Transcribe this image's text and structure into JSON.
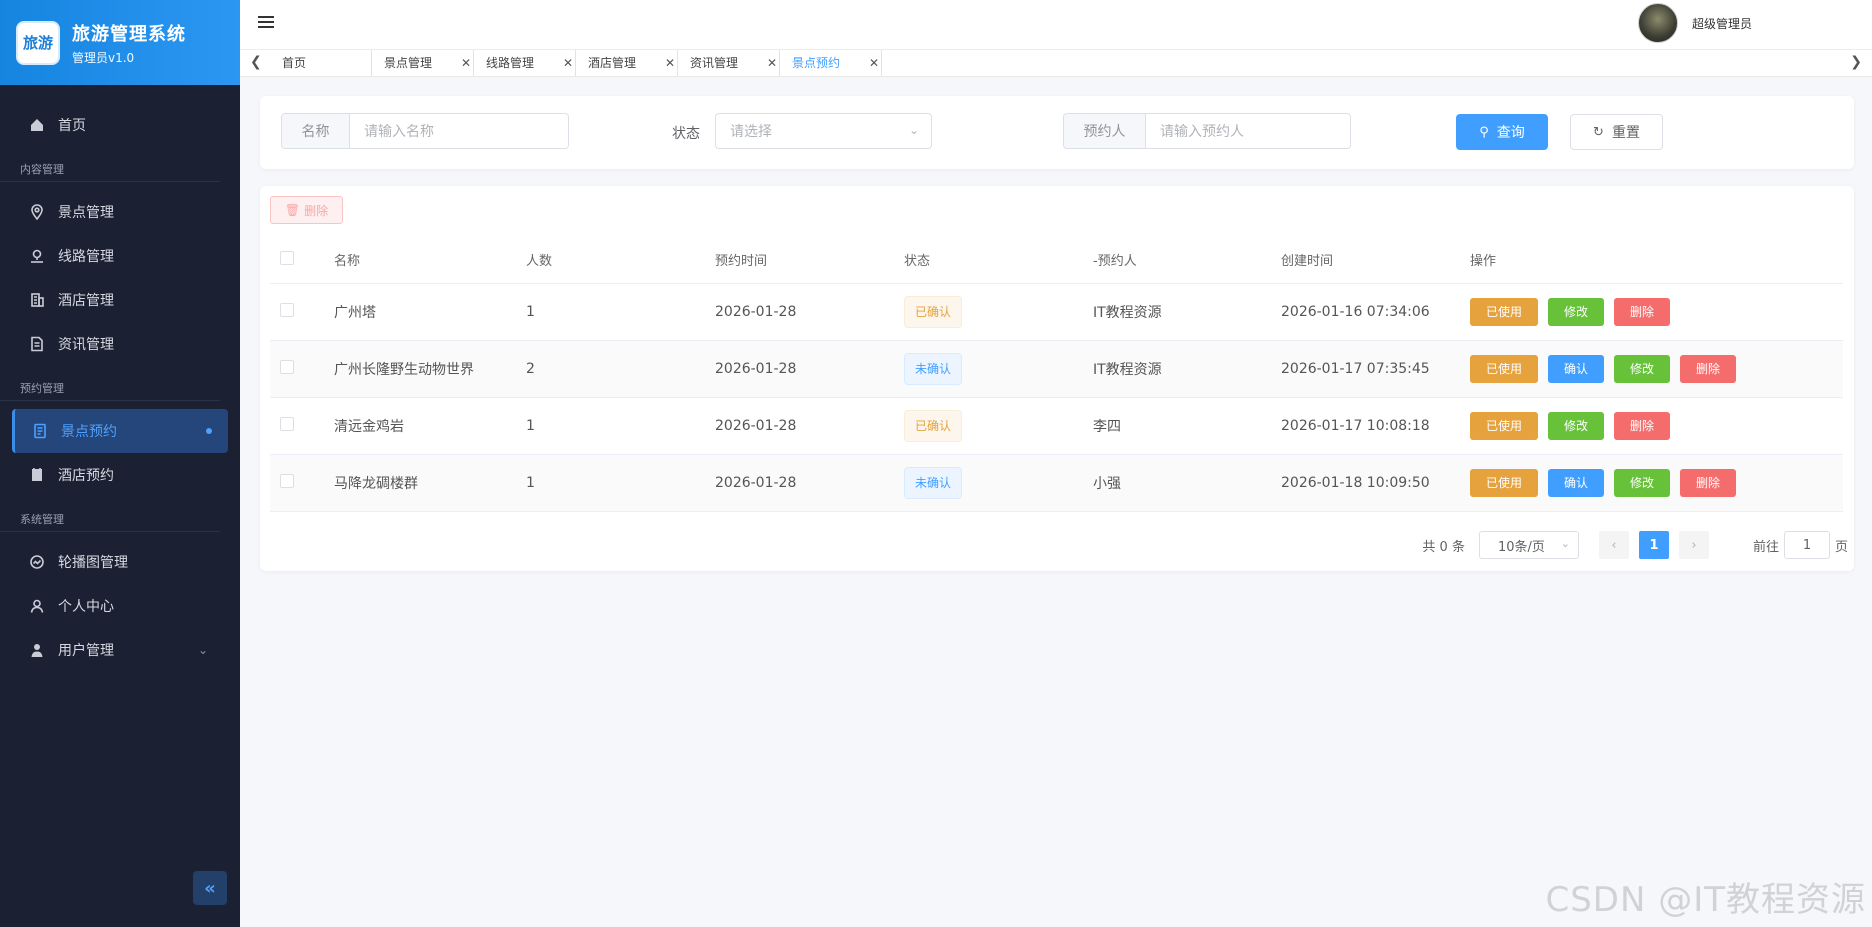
{
  "brand": {
    "logo_text": "旅游",
    "title": "旅游管理系统",
    "subtitle": "管理员v1.0"
  },
  "sidebar": {
    "home": "首页",
    "groups": {
      "content": "内容管理",
      "booking": "预约管理",
      "system": "系统管理"
    },
    "items": {
      "scenic": "景点管理",
      "route": "线路管理",
      "hotel": "酒店管理",
      "news": "资讯管理",
      "scenic_booking": "景点预约",
      "hotel_booking": "酒店预约",
      "carousel": "轮播图管理",
      "profile": "个人中心",
      "users": "用户管理"
    },
    "collapse_icon": "double-chevron-left-icon"
  },
  "header": {
    "user_name": "超级管理员"
  },
  "tabs": [
    {
      "label": "首页",
      "closable": false
    },
    {
      "label": "景点管理",
      "closable": true
    },
    {
      "label": "线路管理",
      "closable": true
    },
    {
      "label": "酒店管理",
      "closable": true
    },
    {
      "label": "资讯管理",
      "closable": true
    },
    {
      "label": "景点预约",
      "closable": true,
      "active": true
    }
  ],
  "search": {
    "name_label": "名称",
    "name_placeholder": "请输入名称",
    "status_label": "状态",
    "status_placeholder": "请选择",
    "person_label": "预约人",
    "person_placeholder": "请输入预约人",
    "query_label": "查询",
    "reset_label": "重置"
  },
  "toolbar": {
    "delete_label": "删除"
  },
  "table": {
    "headers": [
      "名称",
      "人数",
      "预约时间",
      "状态",
      "-预约人",
      "创建时间",
      "操作"
    ],
    "rows": [
      {
        "name": "广州塔",
        "count": "1",
        "time": "2026-01-28",
        "status": "已确认",
        "person": "IT教程资源",
        "created": "2026-01-16 07:34:06",
        "confirmed": true
      },
      {
        "name": "广州长隆野生动物世界",
        "count": "2",
        "time": "2026-01-28",
        "status": "未确认",
        "person": "IT教程资源",
        "created": "2026-01-17 07:35:45",
        "confirmed": false
      },
      {
        "name": "清远金鸡岩",
        "count": "1",
        "time": "2026-01-28",
        "status": "已确认",
        "person": "李四",
        "created": "2026-01-17 10:08:18",
        "confirmed": true
      },
      {
        "name": "马降龙碉楼群",
        "count": "1",
        "time": "2026-01-28",
        "status": "未确认",
        "person": "小强",
        "created": "2026-01-18 10:09:50",
        "confirmed": false
      }
    ],
    "ops": {
      "used": "已使用",
      "confirm": "确认",
      "edit": "修改",
      "delete": "删除"
    }
  },
  "pagination": {
    "total": "共 0 条",
    "page_size": "10条/页",
    "current_page": "1",
    "goto_label": "前往",
    "goto_value": "1",
    "page_suffix": "页"
  },
  "watermark": "CSDN @IT教程资源",
  "colors": {
    "primary": "#409eff",
    "warning": "#e6a23c",
    "success": "#67c23a",
    "danger": "#f56c6c",
    "sidebar_bg": "#1b2133"
  }
}
